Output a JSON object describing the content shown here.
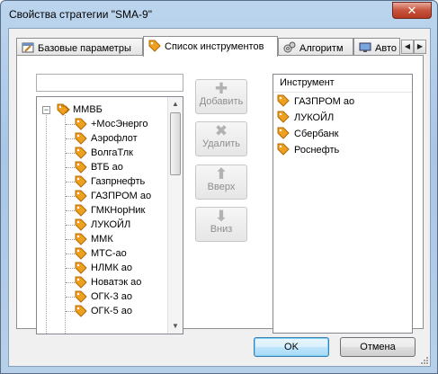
{
  "window": {
    "title": "Свойства стратегии \"SMA-9\"",
    "close_glyph": "✕"
  },
  "tabs": [
    {
      "label": "Базовые параметры",
      "icon": "settings-window-icon"
    },
    {
      "label": "Список инструментов",
      "icon": "tag-icon",
      "active": true
    },
    {
      "label": "Алгоритм",
      "icon": "gears-icon"
    },
    {
      "label": "Авто",
      "icon": "monitor-icon"
    }
  ],
  "tab_scroll": {
    "left": "◀",
    "right": "▶"
  },
  "search": {
    "value": ""
  },
  "tree": {
    "root": {
      "label": "ММВБ",
      "expander": "−"
    },
    "items": [
      "+МосЭнерго",
      "Аэрофлот",
      "ВолгаТлк",
      "ВТБ ао",
      "Газпрнефть",
      "ГАЗПРОМ ао",
      "ГМКНорНик",
      "ЛУКОЙЛ",
      "ММК",
      "МТС-ао",
      "НЛМК ао",
      "Новатэк ао",
      "ОГК-3 ао",
      "ОГК-5 ао"
    ]
  },
  "buttons": {
    "add": {
      "label": "Добавить",
      "glyph": "✚"
    },
    "remove": {
      "label": "Удалить",
      "glyph": "✖"
    },
    "up": {
      "label": "Вверх",
      "glyph": "⬆"
    },
    "down": {
      "label": "Вниз",
      "glyph": "⬇"
    },
    "ok": "OK",
    "cancel": "Отмена"
  },
  "instruments": {
    "header": "Инструмент",
    "items": [
      "ГАЗПРОМ ао",
      "ЛУКОЙЛ",
      "Сбербанк",
      "Роснефть"
    ]
  },
  "colors": {
    "tag": "#f0a020",
    "tag_outline": "#b06a00",
    "window_frame": "#a9c6e6"
  }
}
